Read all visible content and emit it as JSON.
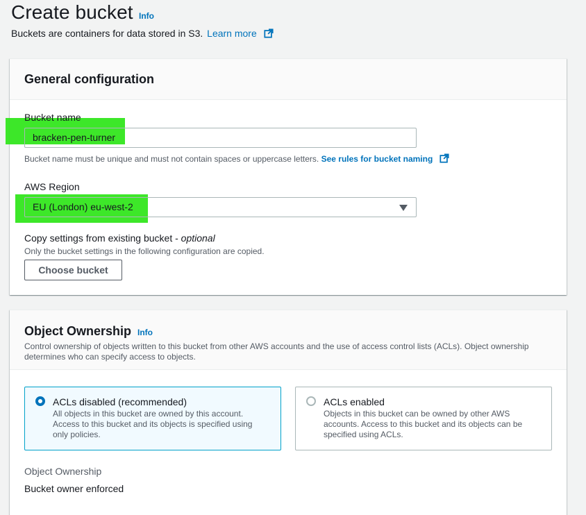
{
  "header": {
    "title": "Create bucket",
    "info": "Info",
    "description": "Buckets are containers for data stored in S3.",
    "learn_more": "Learn more"
  },
  "general_configuration": {
    "title": "General configuration",
    "bucket_name": {
      "label": "Bucket name",
      "value": "bracken-pen-turner",
      "description": "Bucket name must be unique and must not contain spaces or uppercase letters.",
      "rules_link": "See rules for bucket naming"
    },
    "region": {
      "label": "AWS Region",
      "selected": "EU (London) eu-west-2"
    },
    "copy_settings": {
      "label": "Copy settings from existing bucket - ",
      "optional": "optional",
      "description": "Only the bucket settings in the following configuration are copied.",
      "button": "Choose bucket"
    }
  },
  "object_ownership": {
    "title": "Object Ownership",
    "info": "Info",
    "description": "Control ownership of objects written to this bucket from other AWS accounts and the use of access control lists (ACLs). Object ownership determines who can specify access to objects.",
    "options": [
      {
        "title": "ACLs disabled (recommended)",
        "description": "All objects in this bucket are owned by this account. Access to this bucket and its objects is specified using only policies.",
        "selected": true
      },
      {
        "title": "ACLs enabled",
        "description": "Objects in this bucket can be owned by other AWS accounts. Access to this bucket and its objects can be specified using ACLs.",
        "selected": false
      }
    ],
    "summary_label": "Object Ownership",
    "summary_value": "Bucket owner enforced"
  },
  "colors": {
    "link": "#0073bb",
    "highlight": "#33e61e",
    "selected_border": "#00a1c9"
  },
  "icons": {
    "external_link": "external-link-icon",
    "dropdown": "caret-down-icon"
  }
}
